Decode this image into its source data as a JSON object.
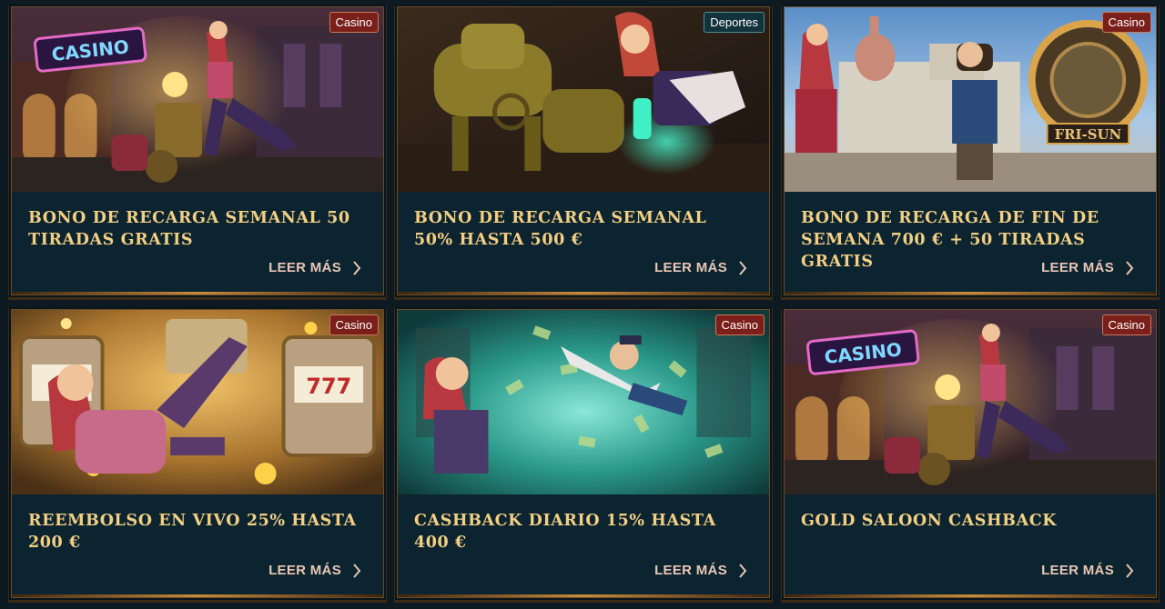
{
  "read_more_label": "LEER MÁS",
  "cards": [
    {
      "badge": "Casino",
      "title": "BONO DE RECARGA SEMANAL 50 TIRADAS GRATIS",
      "scene_sign": "CASINO"
    },
    {
      "badge": "Deportes",
      "title": "BONO DE RECARGA SEMANAL 50% HASTA 500 €"
    },
    {
      "badge": "Casino",
      "title": "BONO DE RECARGA DE FIN DE SEMANA 700 € + 50 TIRADAS GRATIS",
      "scene_sign": "FRI-SUN"
    },
    {
      "badge": "Casino",
      "title": "REEMBOLSO EN VIVO 25% HASTA 200 €"
    },
    {
      "badge": "Casino",
      "title": "CASHBACK DIARIO 15% HASTA 400 €"
    },
    {
      "badge": "Casino",
      "title": "GOLD SALOON CASHBACK",
      "scene_sign": "CASINO"
    }
  ],
  "colors": {
    "title": "#f2cf83",
    "card_bg": "#0c2330",
    "page_bg": "#0d1a22",
    "casino_badge": "#7a1f1a",
    "sports_badge": "#12323c"
  },
  "icons": {
    "read_more": "chevron-right-icon"
  }
}
